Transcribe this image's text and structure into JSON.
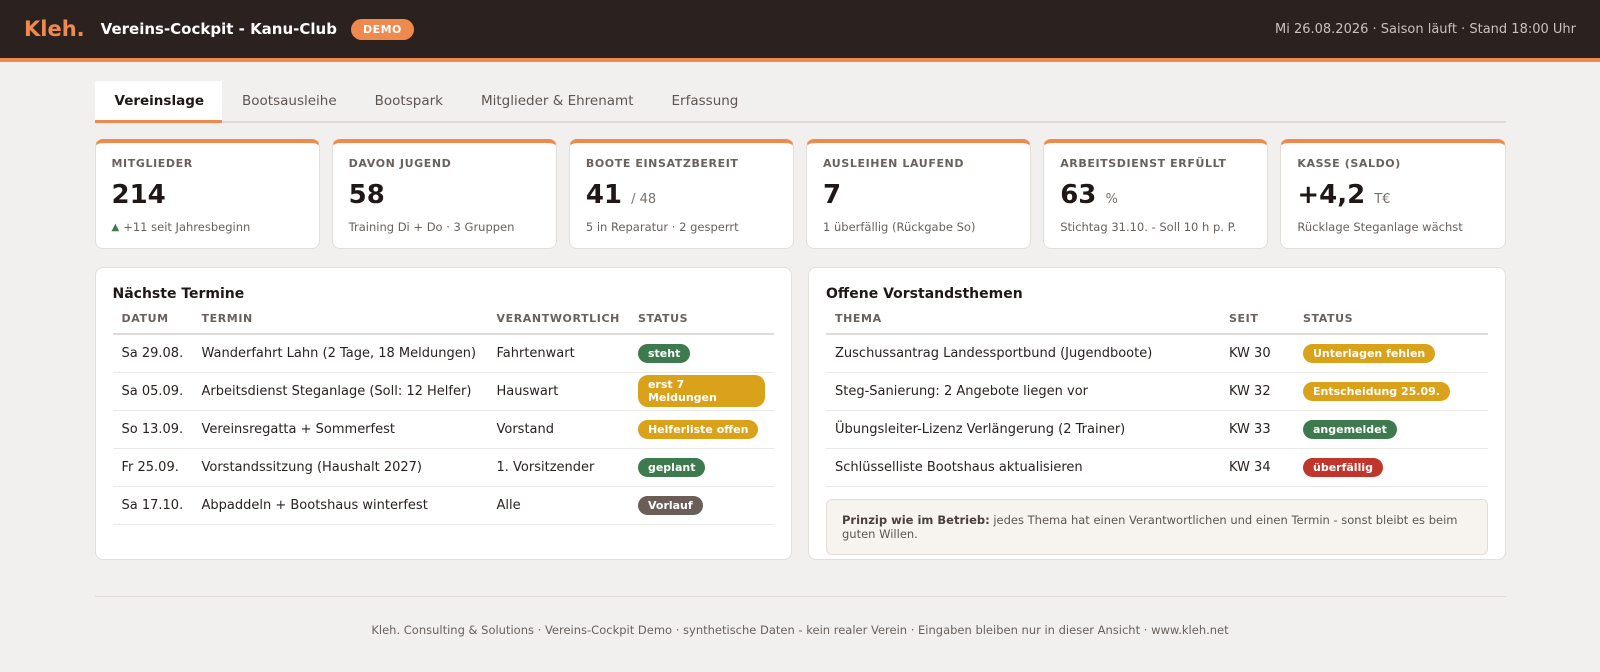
{
  "header": {
    "logo": "Kleh.",
    "title": "Vereins-Cockpit - Kanu-Club",
    "badge": "DEMO",
    "status": "Mi 26.08.2026 · Saison läuft · Stand 18:00 Uhr"
  },
  "tabs": [
    {
      "label": "Vereinslage",
      "active": true
    },
    {
      "label": "Bootsausleihe"
    },
    {
      "label": "Bootspark"
    },
    {
      "label": "Mitglieder & Ehrenamt"
    },
    {
      "label": "Erfassung"
    }
  ],
  "kpis": [
    {
      "label": "MITGLIEDER",
      "value": "214",
      "unit": "",
      "sub": "+11 seit Jahresbeginn",
      "icon": "triangle-up-icon"
    },
    {
      "label": "DAVON JUGEND",
      "value": "58",
      "unit": "",
      "sub": "Training Di + Do · 3 Gruppen"
    },
    {
      "label": "BOOTE EINSATZBEREIT",
      "value": "41",
      "unit": "/ 48",
      "sub": "5 in Reparatur · 2 gesperrt"
    },
    {
      "label": "AUSLEIHEN LAUFEND",
      "value": "7",
      "unit": "",
      "sub": "1 überfällig (Rückgabe So)"
    },
    {
      "label": "ARBEITSDIENST ERFÜLLT",
      "value": "63",
      "unit": "%",
      "sub": "Stichtag 31.10. - Soll 10 h p. P."
    },
    {
      "label": "KASSE (SALDO)",
      "value": "+4,2",
      "unit": "T€",
      "sub": "Rücklage Steganlage wächst"
    }
  ],
  "termine": {
    "title": "Nächste Termine",
    "columns": [
      "DATUM",
      "TERMIN",
      "VERANTWORTLICH",
      "STATUS"
    ],
    "rows": [
      {
        "datum": "Sa 29.08.",
        "termin": "Wanderfahrt Lahn (2 Tage, 18 Meldungen)",
        "verantwortlich": "Fahrtenwart",
        "status": "steht",
        "color": "green"
      },
      {
        "datum": "Sa 05.09.",
        "termin": "Arbeitsdienst Steganlage (Soll: 12 Helfer)",
        "verantwortlich": "Hauswart",
        "status": "erst 7 Meldungen",
        "color": "yellow"
      },
      {
        "datum": "So 13.09.",
        "termin": "Vereinsregatta + Sommerfest",
        "verantwortlich": "Vorstand",
        "status": "Helferliste offen",
        "color": "yellow"
      },
      {
        "datum": "Fr 25.09.",
        "termin": "Vorstandssitzung (Haushalt 2027)",
        "verantwortlich": "1. Vorsitzender",
        "status": "geplant",
        "color": "green"
      },
      {
        "datum": "Sa 17.10.",
        "termin": "Abpaddeln + Bootshaus winterfest",
        "verantwortlich": "Alle",
        "status": "Vorlauf",
        "color": "gray"
      }
    ]
  },
  "themen": {
    "title": "Offene Vorstandsthemen",
    "columns": [
      "THEMA",
      "SEIT",
      "STATUS"
    ],
    "rows": [
      {
        "thema": "Zuschussantrag Landessportbund (Jugendboote)",
        "seit": "KW 30",
        "status": "Unterlagen fehlen",
        "color": "yellow"
      },
      {
        "thema": "Steg-Sanierung: 2 Angebote liegen vor",
        "seit": "KW 32",
        "status": "Entscheidung 25.09.",
        "color": "yellow"
      },
      {
        "thema": "Übungsleiter-Lizenz Verlängerung (2 Trainer)",
        "seit": "KW 33",
        "status": "angemeldet",
        "color": "green"
      },
      {
        "thema": "Schlüsselliste Bootshaus aktualisieren",
        "seit": "KW 34",
        "status": "überfällig",
        "color": "red"
      }
    ],
    "note_strong": "Prinzip wie im Betrieb:",
    "note_text": " jedes Thema hat einen Verantwortlichen und einen Termin - sonst bleibt es beim guten Willen."
  },
  "footer": "Kleh. Consulting & Solutions · Vereins-Cockpit Demo · synthetische Daten - kein realer Verein · Eingaben bleiben nur in dieser Ansicht · www.kleh.net"
}
